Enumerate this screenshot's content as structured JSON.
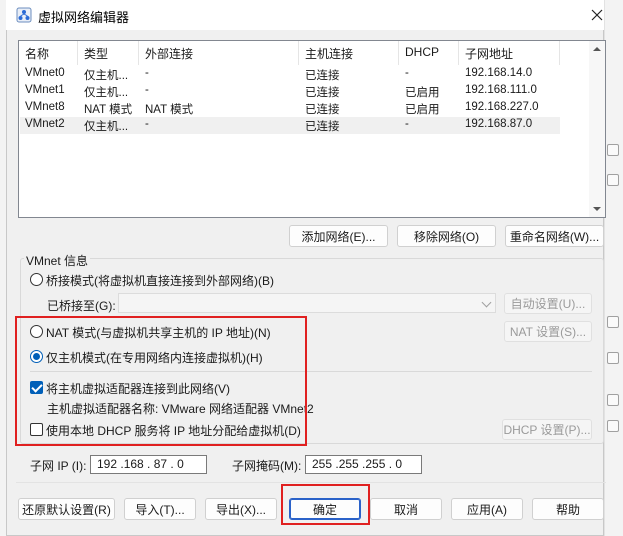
{
  "window": {
    "title": "虚拟网络编辑器"
  },
  "columns": [
    "名称",
    "类型",
    "外部连接",
    "主机连接",
    "DHCP",
    "子网地址"
  ],
  "rows": [
    [
      "VMnet0",
      "仅主机...",
      "-",
      "已连接",
      "-",
      "192.168.14.0"
    ],
    [
      "VMnet1",
      "仅主机...",
      "-",
      "已连接",
      "已启用",
      "192.168.111.0"
    ],
    [
      "VMnet8",
      "NAT 模式",
      "NAT 模式",
      "已连接",
      "已启用",
      "192.168.227.0"
    ],
    [
      "VMnet2",
      "仅主机...",
      "-",
      "已连接",
      "-",
      "192.168.87.0"
    ]
  ],
  "selected_row": 3,
  "list_buttons": {
    "add": "添加网络(E)...",
    "remove": "移除网络(O)",
    "rename": "重命名网络(W)..."
  },
  "vmnet_info": {
    "title": "VMnet 信息",
    "bridge_mode": "桥接模式(将虚拟机直接连接到外部网络)(B)",
    "bridged_to_label": "已桥接至(G):",
    "auto_settings": "自动设置(U)...",
    "nat_mode": "NAT 模式(与虚拟机共享主机的 IP 地址)(N)",
    "nat_settings": "NAT 设置(S)...",
    "host_only_mode": "仅主机模式(在专用网络内连接虚拟机)(H)",
    "connect_adapter": "将主机虚拟适配器连接到此网络(V)",
    "adapter_name": "主机虚拟适配器名称: VMware 网络适配器 VMnet2",
    "use_dhcp": "使用本地 DHCP 服务将 IP 地址分配给虚拟机(D)",
    "dhcp_settings": "DHCP 设置(P)...",
    "subnet_ip_label": "子网 IP (I):",
    "subnet_ip": "192 .168 . 87 . 0",
    "subnet_mask_label": "子网掩码(M):",
    "subnet_mask": "255 .255 .255 . 0",
    "selected_mode": "host_only",
    "connect_adapter_checked": true,
    "use_dhcp_checked": false
  },
  "footer_buttons": {
    "restore": "还原默认设置(R)",
    "import": "导入(T)...",
    "export": "导出(X)...",
    "ok": "确定",
    "cancel": "取消",
    "apply": "应用(A)",
    "help": "帮助"
  },
  "colors": {
    "accent": "#005fb8",
    "highlight_box": "#e02020",
    "dialog_bg": "#f0f0f0"
  }
}
